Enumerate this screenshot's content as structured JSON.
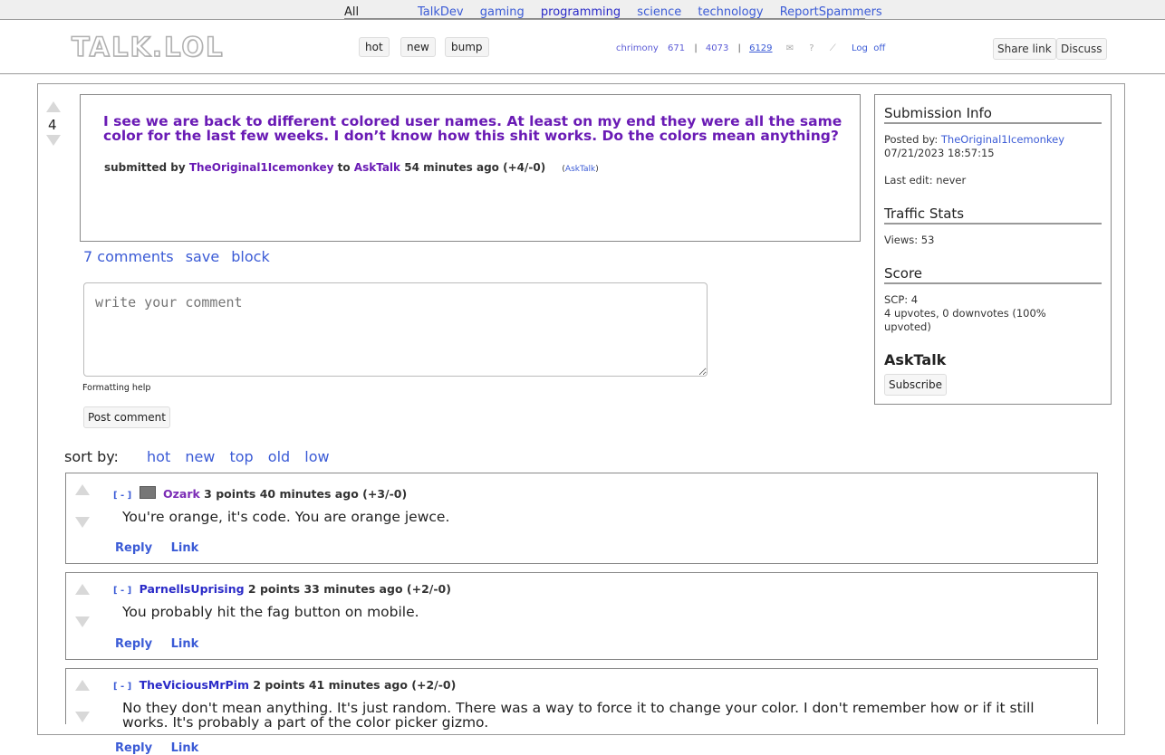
{
  "topnav": {
    "all": "All",
    "subs": [
      "TalkDev",
      "gaming",
      "programming",
      "science",
      "technology",
      "ReportSpammers"
    ]
  },
  "header": {
    "logo": "TALK.LOL",
    "sort_buttons": [
      "hot",
      "new",
      "bump"
    ],
    "user": {
      "name": "chrimony",
      "stat1": "671",
      "stat2": "4073",
      "stat3": "6129",
      "sep": "|",
      "logoff": "Log  off"
    },
    "share_label": "Share link",
    "discuss_label": "Discuss"
  },
  "submission": {
    "score": "4",
    "title": "I see we are back to different colored user names. At least on my end they were all the same color for the last few weeks. I don’t know how this shit works. Do the colors mean anything?",
    "submitted_by": "submitted by",
    "author": "TheOriginal1Icemonkey",
    "to": "to",
    "sub": "AskTalk",
    "time": "54 minutes ago (+4/-0)",
    "domain_open": "(",
    "domain": "AskTalk",
    "domain_close": ")",
    "comments_link": "7 comments",
    "save_link": "save",
    "block_link": "block"
  },
  "comment_form": {
    "placeholder": "write your comment",
    "formatting_help": "Formatting help",
    "post_label": "Post comment"
  },
  "sidebar": {
    "info_heading": "Submission Info",
    "posted_by_label": "Posted by:",
    "posted_by": "TheOriginal1Icemonkey",
    "date": "07/21/2023 18:57:15",
    "last_edit": "Last edit: never",
    "traffic_heading": "Traffic Stats",
    "views": "Views: 53",
    "score_heading": "Score",
    "scp": "SCP: 4",
    "votes": "4 upvotes, 0 downvotes (100% upvoted)",
    "sub_name": "AskTalk",
    "subscribe_label": "Subscribe"
  },
  "sort": {
    "label": "sort by:",
    "options": [
      "hot",
      "new",
      "top",
      "old",
      "low"
    ]
  },
  "comments": [
    {
      "toggle": "[ - ]",
      "user": "Ozark",
      "meta": "3 points 40 minutes ago (+3/-0)",
      "body": "You're orange, it's code. You are orange jewce.",
      "reply": "Reply",
      "link": "Link"
    },
    {
      "toggle": "[ - ]",
      "user": "ParnellsUprising",
      "meta": "2 points 33 minutes ago (+2/-0)",
      "body": "You probably hit the fag button on mobile.",
      "reply": "Reply",
      "link": "Link"
    },
    {
      "toggle": "[ - ]",
      "user": "TheViciousMrPim",
      "meta": "2 points 41 minutes ago (+2/-0)",
      "body": "No they don't mean anything. It's just random. There was a way to force it to change your color. I don't remember how or if it still works. It's probably a part of the color picker gizmo.",
      "reply": "Reply",
      "link": "Link"
    }
  ],
  "colors": {
    "title_purple": "#6a1bb5",
    "link_blue": "#3b5bd6",
    "border_gray": "#888888"
  }
}
